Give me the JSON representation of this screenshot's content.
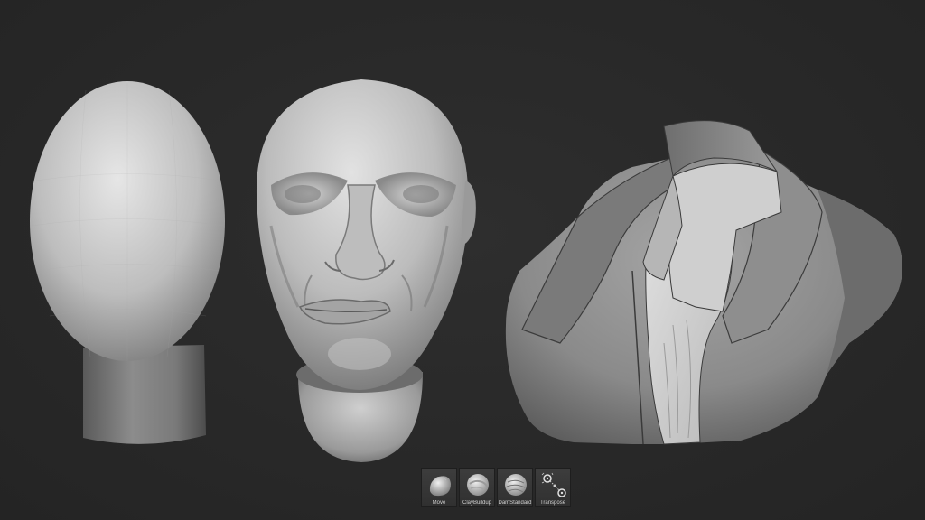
{
  "viewport": {
    "background_color": "#2a2a2a",
    "models": [
      {
        "name": "mannequin-head-model",
        "description_icon": "mannequin-head"
      },
      {
        "name": "sculpted-face-model",
        "description_icon": "sculpted-face"
      },
      {
        "name": "jacket-bust-model",
        "description_icon": "jacket-bust"
      }
    ]
  },
  "brush_shelf": {
    "brushes": [
      {
        "label": "Move",
        "icon": "move-brush-icon"
      },
      {
        "label": "ClayBuildup",
        "icon": "claybuildup-brush-icon"
      },
      {
        "label": "DamStandard",
        "icon": "damstandard-brush-icon"
      },
      {
        "label": "Transpose",
        "icon": "transpose-icon"
      }
    ]
  }
}
